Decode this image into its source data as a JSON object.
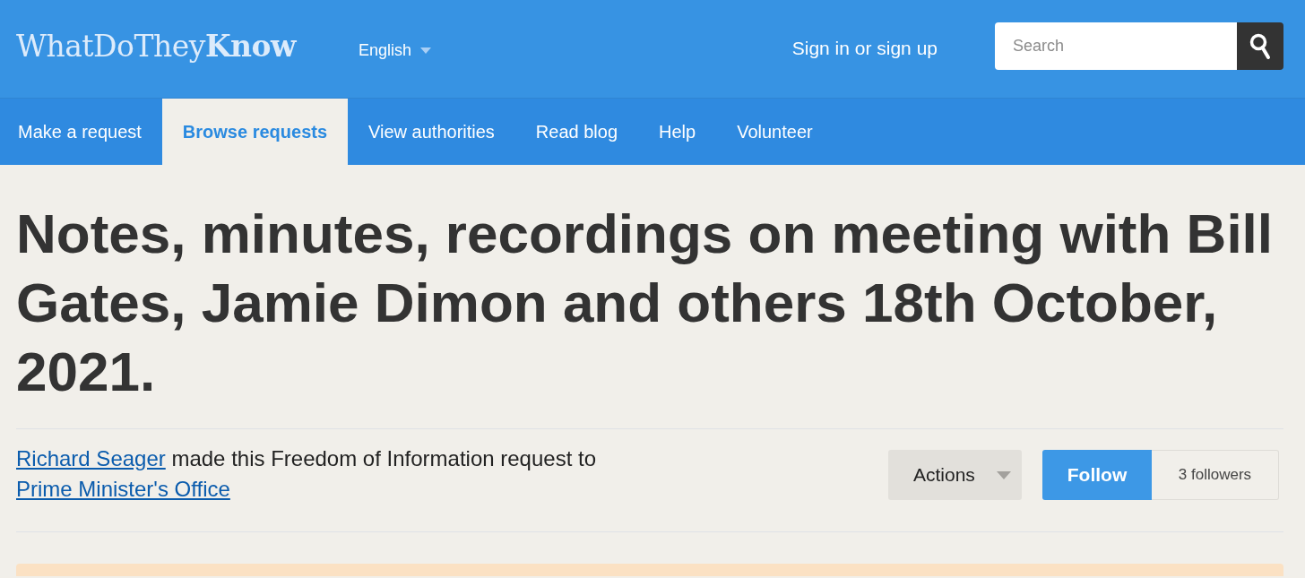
{
  "header": {
    "logo": "WhatDoThey**Know**",
    "language": "English",
    "sign_in": "Sign in or sign up",
    "search": {
      "placeholder": "Search"
    }
  },
  "nav": [
    {
      "label": "Make a request",
      "selected": false
    },
    {
      "label": "Browse requests",
      "selected": true
    },
    {
      "label": "View authorities",
      "selected": false
    },
    {
      "label": "Read blog",
      "selected": false
    },
    {
      "label": "Help",
      "selected": false
    },
    {
      "label": "Volunteer",
      "selected": false
    }
  ],
  "request": {
    "title": "Notes, minutes, recordings on meeting with Bill Gates, Jamie Dimon and others 18th October, 2021.",
    "byline": {
      "requester": "Richard Seager",
      "text": " made this Freedom of Information request to ",
      "authority": "Prime Minister's Office"
    },
    "actions": "Actions",
    "follow": {
      "label": "Follow",
      "count": "3 followers"
    }
  }
}
